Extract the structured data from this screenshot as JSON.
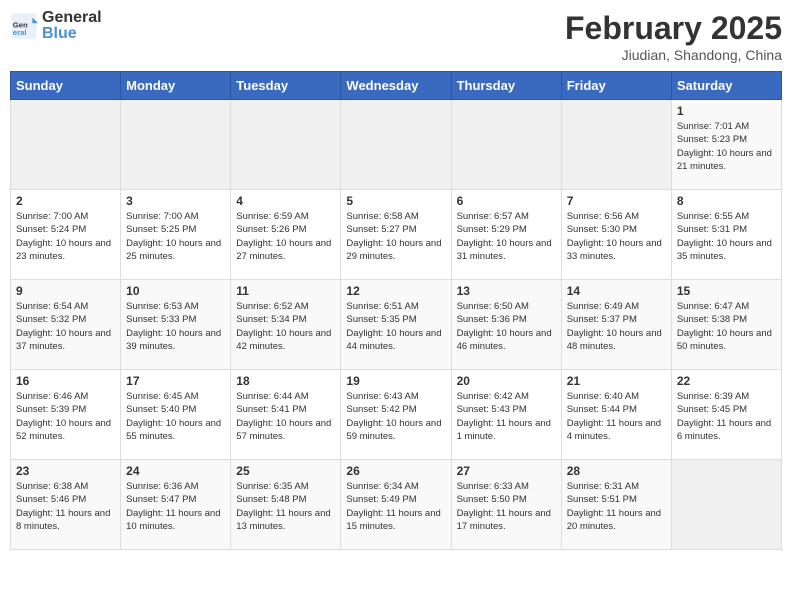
{
  "header": {
    "logo_general": "General",
    "logo_blue": "Blue",
    "title": "February 2025",
    "subtitle": "Jiudian, Shandong, China"
  },
  "days_of_week": [
    "Sunday",
    "Monday",
    "Tuesday",
    "Wednesday",
    "Thursday",
    "Friday",
    "Saturday"
  ],
  "weeks": [
    [
      {
        "day": "",
        "info": ""
      },
      {
        "day": "",
        "info": ""
      },
      {
        "day": "",
        "info": ""
      },
      {
        "day": "",
        "info": ""
      },
      {
        "day": "",
        "info": ""
      },
      {
        "day": "",
        "info": ""
      },
      {
        "day": "1",
        "info": "Sunrise: 7:01 AM\nSunset: 5:23 PM\nDaylight: 10 hours and 21 minutes."
      }
    ],
    [
      {
        "day": "2",
        "info": "Sunrise: 7:00 AM\nSunset: 5:24 PM\nDaylight: 10 hours and 23 minutes."
      },
      {
        "day": "3",
        "info": "Sunrise: 7:00 AM\nSunset: 5:25 PM\nDaylight: 10 hours and 25 minutes."
      },
      {
        "day": "4",
        "info": "Sunrise: 6:59 AM\nSunset: 5:26 PM\nDaylight: 10 hours and 27 minutes."
      },
      {
        "day": "5",
        "info": "Sunrise: 6:58 AM\nSunset: 5:27 PM\nDaylight: 10 hours and 29 minutes."
      },
      {
        "day": "6",
        "info": "Sunrise: 6:57 AM\nSunset: 5:29 PM\nDaylight: 10 hours and 31 minutes."
      },
      {
        "day": "7",
        "info": "Sunrise: 6:56 AM\nSunset: 5:30 PM\nDaylight: 10 hours and 33 minutes."
      },
      {
        "day": "8",
        "info": "Sunrise: 6:55 AM\nSunset: 5:31 PM\nDaylight: 10 hours and 35 minutes."
      }
    ],
    [
      {
        "day": "9",
        "info": "Sunrise: 6:54 AM\nSunset: 5:32 PM\nDaylight: 10 hours and 37 minutes."
      },
      {
        "day": "10",
        "info": "Sunrise: 6:53 AM\nSunset: 5:33 PM\nDaylight: 10 hours and 39 minutes."
      },
      {
        "day": "11",
        "info": "Sunrise: 6:52 AM\nSunset: 5:34 PM\nDaylight: 10 hours and 42 minutes."
      },
      {
        "day": "12",
        "info": "Sunrise: 6:51 AM\nSunset: 5:35 PM\nDaylight: 10 hours and 44 minutes."
      },
      {
        "day": "13",
        "info": "Sunrise: 6:50 AM\nSunset: 5:36 PM\nDaylight: 10 hours and 46 minutes."
      },
      {
        "day": "14",
        "info": "Sunrise: 6:49 AM\nSunset: 5:37 PM\nDaylight: 10 hours and 48 minutes."
      },
      {
        "day": "15",
        "info": "Sunrise: 6:47 AM\nSunset: 5:38 PM\nDaylight: 10 hours and 50 minutes."
      }
    ],
    [
      {
        "day": "16",
        "info": "Sunrise: 6:46 AM\nSunset: 5:39 PM\nDaylight: 10 hours and 52 minutes."
      },
      {
        "day": "17",
        "info": "Sunrise: 6:45 AM\nSunset: 5:40 PM\nDaylight: 10 hours and 55 minutes."
      },
      {
        "day": "18",
        "info": "Sunrise: 6:44 AM\nSunset: 5:41 PM\nDaylight: 10 hours and 57 minutes."
      },
      {
        "day": "19",
        "info": "Sunrise: 6:43 AM\nSunset: 5:42 PM\nDaylight: 10 hours and 59 minutes."
      },
      {
        "day": "20",
        "info": "Sunrise: 6:42 AM\nSunset: 5:43 PM\nDaylight: 11 hours and 1 minute."
      },
      {
        "day": "21",
        "info": "Sunrise: 6:40 AM\nSunset: 5:44 PM\nDaylight: 11 hours and 4 minutes."
      },
      {
        "day": "22",
        "info": "Sunrise: 6:39 AM\nSunset: 5:45 PM\nDaylight: 11 hours and 6 minutes."
      }
    ],
    [
      {
        "day": "23",
        "info": "Sunrise: 6:38 AM\nSunset: 5:46 PM\nDaylight: 11 hours and 8 minutes."
      },
      {
        "day": "24",
        "info": "Sunrise: 6:36 AM\nSunset: 5:47 PM\nDaylight: 11 hours and 10 minutes."
      },
      {
        "day": "25",
        "info": "Sunrise: 6:35 AM\nSunset: 5:48 PM\nDaylight: 11 hours and 13 minutes."
      },
      {
        "day": "26",
        "info": "Sunrise: 6:34 AM\nSunset: 5:49 PM\nDaylight: 11 hours and 15 minutes."
      },
      {
        "day": "27",
        "info": "Sunrise: 6:33 AM\nSunset: 5:50 PM\nDaylight: 11 hours and 17 minutes."
      },
      {
        "day": "28",
        "info": "Sunrise: 6:31 AM\nSunset: 5:51 PM\nDaylight: 11 hours and 20 minutes."
      },
      {
        "day": "",
        "info": ""
      }
    ]
  ]
}
